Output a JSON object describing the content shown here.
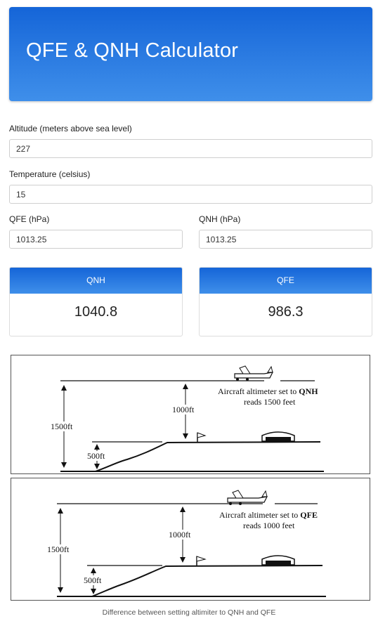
{
  "header": {
    "title": "QFE & QNH Calculator"
  },
  "form": {
    "altitude": {
      "label": "Altitude (meters above sea level)",
      "value": "227"
    },
    "temperature": {
      "label": "Temperature (celsius)",
      "value": "15"
    },
    "qfe": {
      "label": "QFE (hPa)",
      "value": "1013.25"
    },
    "qnh": {
      "label": "QNH (hPa)",
      "value": "1013.25"
    }
  },
  "results": {
    "qnh": {
      "title": "QNH",
      "value": "1040.8"
    },
    "qfe": {
      "title": "QFE",
      "value": "986.3"
    }
  },
  "diagram_qnh": {
    "line1": "Aircraft altimeter set to",
    "setting": "QNH",
    "line2": "reads 1500 feet",
    "height_total": "1500ft",
    "height_above_field": "1000ft",
    "field_elevation": "500ft"
  },
  "diagram_qfe": {
    "line1": "Aircraft altimeter set to",
    "setting": "QFE",
    "line2": "reads 1000 feet",
    "height_total": "1500ft",
    "height_above_field": "1000ft",
    "field_elevation": "500ft"
  },
  "caption": "Difference between setting altimiter to QNH and QFE"
}
